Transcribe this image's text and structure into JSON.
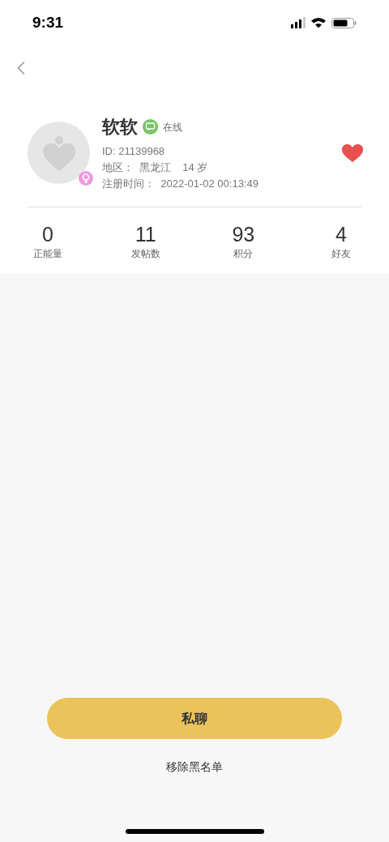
{
  "status_bar": {
    "time": "9:31"
  },
  "profile": {
    "name": "软软",
    "online": true,
    "online_label": "在线",
    "id": "ID: 21139968",
    "region": "地区：  黑龙江",
    "age": "14 岁",
    "registered": "注册时间：  2022-01-02 00:13:49",
    "female": true,
    "favorited": true
  },
  "stats": [
    {
      "value": "0",
      "label": "正能量"
    },
    {
      "value": "11",
      "label": "发帖数"
    },
    {
      "value": "93",
      "label": "积分"
    },
    {
      "value": "4",
      "label": "好友"
    }
  ],
  "actions": {
    "primary": "私聊",
    "secondary": "移除黑名单"
  }
}
